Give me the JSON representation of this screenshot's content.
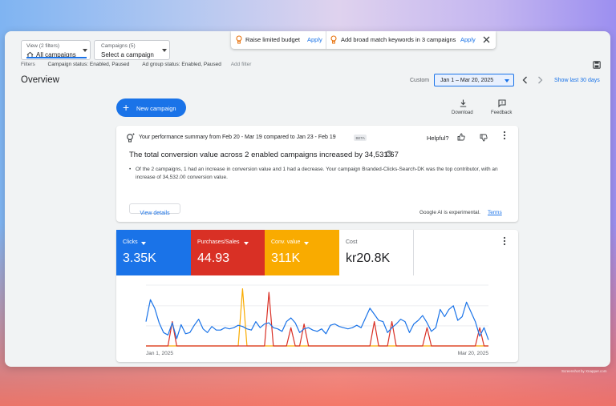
{
  "view_select": {
    "label": "View (2 filters)",
    "value": "All campaigns"
  },
  "campaign_select": {
    "label": "Campaigns (5)",
    "value": "Select a campaign"
  },
  "notifications": [
    {
      "text": "Raise limited budget",
      "action": "Apply"
    },
    {
      "text": "Add broad match keywords in 3 campaigns",
      "action": "Apply"
    }
  ],
  "filters": {
    "label": "Filters",
    "chips": [
      "Campaign status: Enabled, Paused",
      "Ad group status: Enabled, Paused"
    ],
    "add": "Add filter"
  },
  "header": {
    "title": "Overview",
    "date_mode": "Custom",
    "date_range": "Jan 1 – Mar 20, 2025",
    "show_last": "Show last 30 days"
  },
  "actions": {
    "new_campaign": "New campaign",
    "download": "Download",
    "feedback": "Feedback"
  },
  "summary": {
    "header": "Your performance summary from Feb 20 - Mar 19 compared to Jan 23 - Feb 19",
    "beta": "BETA",
    "helpful": "Helpful?",
    "headline": "The total conversion value across 2 enabled campaigns increased by 34,531.67",
    "bullet": "Of the 2 campaigns, 1 had an increase in conversion value and 1 had a decrease. Your campaign Branded-Clicks-Search-DK was the top contributor, with an increase of 34,532.00 conversion value.",
    "view_details": "View details",
    "disclaimer": "Google AI is experimental.",
    "terms": "Terms"
  },
  "metrics": [
    {
      "label": "Clicks",
      "value": "3.35K",
      "color": "#1a73e8",
      "dropdown": true
    },
    {
      "label": "Purchases/Sales",
      "value": "44.93",
      "color": "#d93025",
      "dropdown": true
    },
    {
      "label": "Conv. value",
      "value": "311K",
      "color": "#f9ab00",
      "dropdown": true
    },
    {
      "label": "Cost",
      "value": "kr20.8K",
      "color": "#ffffff",
      "dropdown": false
    }
  ],
  "chart_data": {
    "type": "line",
    "x_start_label": "Jan 1, 2025",
    "x_end_label": "Mar 20, 2025",
    "ylim": [
      0,
      100
    ],
    "series": [
      {
        "name": "Clicks",
        "color": "#1a73e8",
        "values": [
          40,
          76,
          62,
          38,
          22,
          18,
          38,
          12,
          35,
          20,
          22,
          34,
          44,
          28,
          22,
          32,
          26,
          26,
          30,
          28,
          30,
          34,
          32,
          28,
          26,
          40,
          30,
          36,
          38,
          30,
          28,
          24,
          40,
          46,
          38,
          22,
          28,
          30,
          26,
          24,
          28,
          20,
          34,
          36,
          32,
          30,
          28,
          30,
          34,
          30,
          46,
          62,
          52,
          42,
          40,
          22,
          30,
          36,
          44,
          40,
          22,
          36,
          42,
          50,
          38,
          24,
          30,
          60,
          48,
          60,
          66,
          42,
          48,
          72,
          56,
          40,
          16,
          30,
          10
        ]
      },
      {
        "name": "Purchases/Sales",
        "color": "#d93025",
        "values": [
          0,
          0,
          0,
          0,
          0,
          0,
          40,
          0,
          0,
          0,
          0,
          0,
          0,
          0,
          0,
          0,
          0,
          0,
          0,
          0,
          0,
          0,
          0,
          0,
          0,
          0,
          0,
          0,
          88,
          0,
          0,
          0,
          0,
          30,
          0,
          0,
          36,
          0,
          0,
          0,
          0,
          0,
          0,
          0,
          0,
          0,
          0,
          0,
          0,
          0,
          0,
          0,
          40,
          0,
          0,
          0,
          40,
          0,
          0,
          0,
          0,
          0,
          0,
          0,
          30,
          0,
          0,
          0,
          0,
          0,
          0,
          0,
          0,
          0,
          0,
          0,
          30,
          0,
          0
        ]
      },
      {
        "name": "Conv. value",
        "color": "#f9ab00",
        "values": [
          0,
          0,
          0,
          0,
          0,
          0,
          0,
          0,
          0,
          0,
          0,
          0,
          0,
          0,
          0,
          0,
          0,
          0,
          0,
          0,
          0,
          0,
          94,
          0,
          0,
          0,
          0,
          0,
          0,
          0,
          0,
          0,
          0,
          0,
          0,
          0,
          0,
          0,
          0,
          0,
          0,
          0,
          0,
          0,
          0,
          0,
          0,
          0,
          0,
          0,
          0,
          0,
          0,
          0,
          0,
          0,
          0,
          0,
          0,
          0,
          0,
          0,
          0,
          0,
          0,
          0,
          0,
          0,
          0,
          0,
          0,
          0,
          0,
          0,
          0,
          0,
          0,
          0,
          0
        ]
      }
    ]
  },
  "watermark": "Screenshot by Xnapper.com"
}
